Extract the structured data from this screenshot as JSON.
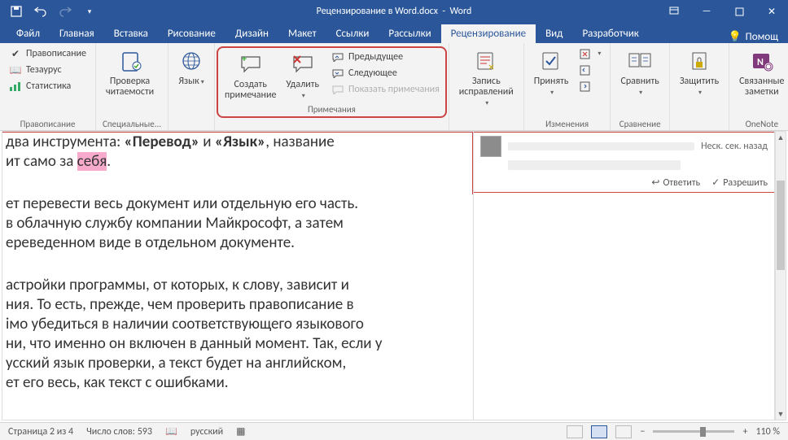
{
  "title": {
    "filename": "Рецензирование в Word.docx",
    "appname": "Word"
  },
  "qat": {
    "save": "save-icon",
    "undo": "undo-icon",
    "redo": "redo-icon",
    "more": "more-icon"
  },
  "tabs": {
    "file": "Файл",
    "home": "Главная",
    "insert": "Вставка",
    "draw": "Рисование",
    "design": "Дизайн",
    "layout": "Макет",
    "references": "Ссылки",
    "mailings": "Рассылки",
    "review": "Рецензирование",
    "view": "Вид",
    "developer": "Разработчик",
    "help": "Помощ"
  },
  "ribbon": {
    "proofing": {
      "label": "Правописание",
      "spelling": "Правописание",
      "thesaurus": "Тезаурус",
      "stats": "Статистика"
    },
    "accessibility": {
      "label": "Специальные...",
      "check": "Проверка\nчитаемости"
    },
    "language": {
      "label": "",
      "lang": "Язык"
    },
    "comments": {
      "label": "Примечания",
      "new": "Создать\nпримечание",
      "delete": "Удалить",
      "prev": "Предыдущее",
      "next": "Следующее",
      "show": "Показать примечания"
    },
    "tracking": {
      "label": "",
      "track": "Запись\nисправлений"
    },
    "changes": {
      "label": "Изменения",
      "accept": "Принять"
    },
    "compare": {
      "label": "Сравнение",
      "compare": "Сравнить"
    },
    "protect": {
      "label": "",
      "protect": "Защитить"
    },
    "onenote": {
      "label": "OneNote",
      "notes": "Связанные\nзаметки"
    }
  },
  "doc": {
    "block1": {
      "l1_a": "два инструмента: ",
      "l1_b": "«Перевод»",
      "l1_c": " и ",
      "l1_d": "«Язык»",
      "l1_e": ", название",
      "l2_a": "ит само за ",
      "l2_hl": "себя",
      "l2_b": "."
    },
    "block2": {
      "l1": "ет перевести весь документ или отдельную его часть.",
      "l2": "в облачную службу компании Майкрософт, а затем",
      "l3": "ереведенном виде в отдельном документе."
    },
    "block3": {
      "l1": "астройки программы, от которых, к слову, зависит и",
      "l2": "ния. То есть, прежде, чем проверить правописание в",
      "l3": "імо убедиться в наличии соответствующего языкового",
      "l4": "ни, что именно он включен в данный момент. Так, если у",
      "l5": "усский язык проверки, а текст будет на английском,",
      "l6": "ет его весь, как текст с ошибками."
    }
  },
  "comment": {
    "time": "Неск. сек. назад",
    "reply": "Ответить",
    "resolve": "Разрешить"
  },
  "status": {
    "page": "Страница 2 из 4",
    "words": "Число слов: 593",
    "lang": "русский",
    "zoom": "110 %"
  }
}
